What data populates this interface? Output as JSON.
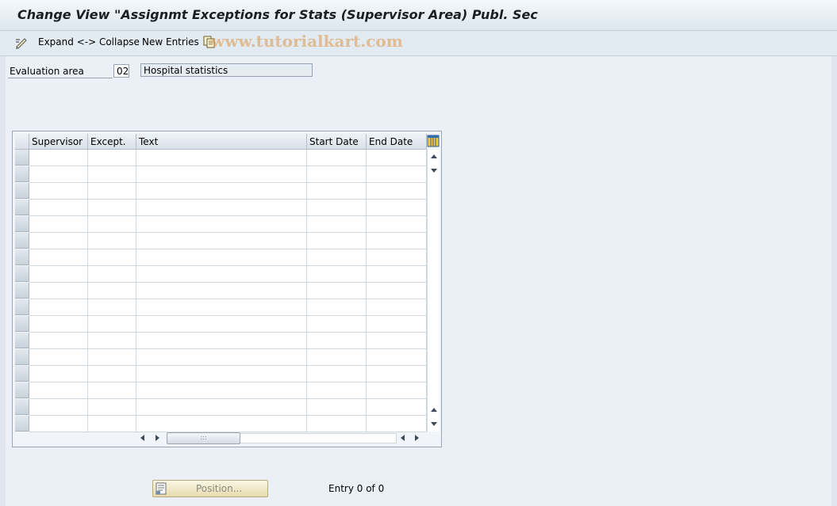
{
  "window": {
    "title": "Change View \"Assignmt Exceptions for Stats (Supervisor Area) Publ. Sec"
  },
  "toolbar": {
    "expand_collapse_label": "Expand <-> Collapse",
    "new_entries_label": "New Entries",
    "watermark": "www.tutorialkart.com"
  },
  "form": {
    "evaluation_area_label": "Evaluation area",
    "evaluation_area_value": "02",
    "evaluation_area_text": "Hospital statistics"
  },
  "table": {
    "columns": [
      "Supervisor",
      "Except.",
      "Text",
      "Start Date",
      "End Date"
    ],
    "rows": []
  },
  "footer": {
    "position_button_label": "Position...",
    "entry_info": "Entry 0 of 0"
  }
}
